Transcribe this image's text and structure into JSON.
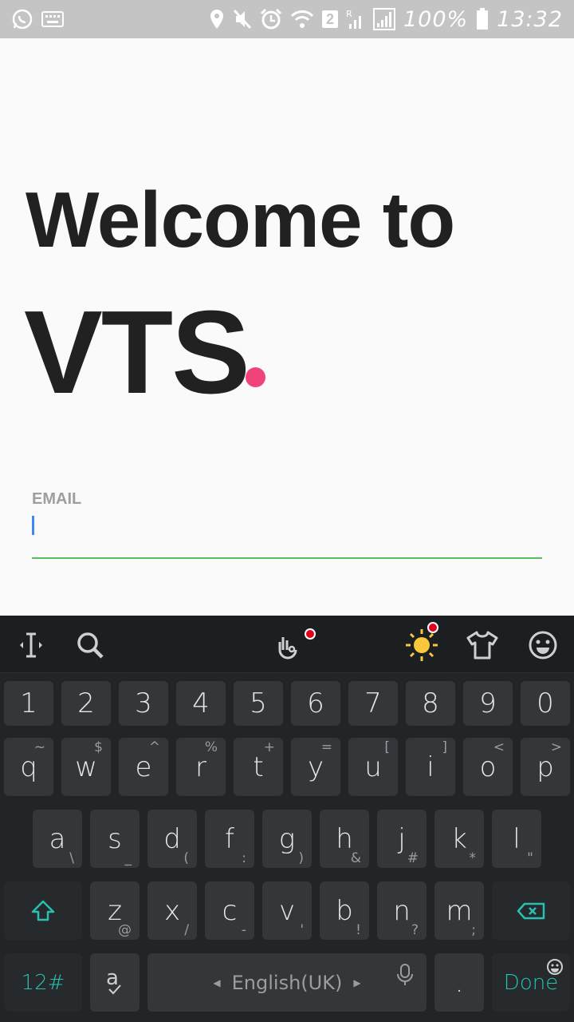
{
  "status_bar": {
    "left_icons": [
      "whatsapp-icon",
      "keyboard-icon"
    ],
    "right_icons": [
      "location-icon",
      "mute-icon",
      "alarm-icon",
      "wifi-icon",
      "sim2-badge",
      "signal-r-icon",
      "signal-icon"
    ],
    "sim_badge": "2",
    "battery_text": "100%",
    "time": "13:32"
  },
  "main": {
    "title_line1": "Welcome to",
    "title_line2": "VTS",
    "dot_color": "#f0437a",
    "email_label": "EMAIL",
    "email_value": "",
    "underline_color": "#5cb85c"
  },
  "keyboard": {
    "toolbar": [
      "cursor-icon",
      "search-icon",
      "gesture-icon",
      "theme-icon",
      "shirt-icon",
      "emoji-icon"
    ],
    "number_row": [
      "1",
      "2",
      "3",
      "4",
      "5",
      "6",
      "7",
      "8",
      "9",
      "0"
    ],
    "row1": [
      {
        "key": "q",
        "sub": "~"
      },
      {
        "key": "w",
        "sub": "$"
      },
      {
        "key": "e",
        "sub": "^"
      },
      {
        "key": "r",
        "sub": "%"
      },
      {
        "key": "t",
        "sub": "+"
      },
      {
        "key": "y",
        "sub": "="
      },
      {
        "key": "u",
        "sub": "["
      },
      {
        "key": "i",
        "sub": "]"
      },
      {
        "key": "o",
        "sub": "<"
      },
      {
        "key": "p",
        "sub": ">"
      }
    ],
    "row2": [
      {
        "key": "a",
        "sub": "\\"
      },
      {
        "key": "s",
        "sub": "_"
      },
      {
        "key": "d",
        "sub": "("
      },
      {
        "key": "f",
        "sub": ":"
      },
      {
        "key": "g",
        "sub": ")"
      },
      {
        "key": "h",
        "sub": "&"
      },
      {
        "key": "j",
        "sub": "#"
      },
      {
        "key": "k",
        "sub": "*"
      },
      {
        "key": "l",
        "sub": "\""
      }
    ],
    "row3": [
      {
        "key": "z",
        "sub": "@"
      },
      {
        "key": "x",
        "sub": "/"
      },
      {
        "key": "c",
        "sub": "-"
      },
      {
        "key": "v",
        "sub": "'"
      },
      {
        "key": "b",
        "sub": "!"
      },
      {
        "key": "n",
        "sub": "?"
      },
      {
        "key": "m",
        "sub": ";"
      }
    ],
    "symbols_label": "12#",
    "space_label": "English(UK)",
    "period_label": ".",
    "done_label": "Done",
    "accent_color": "#28c0b1"
  }
}
